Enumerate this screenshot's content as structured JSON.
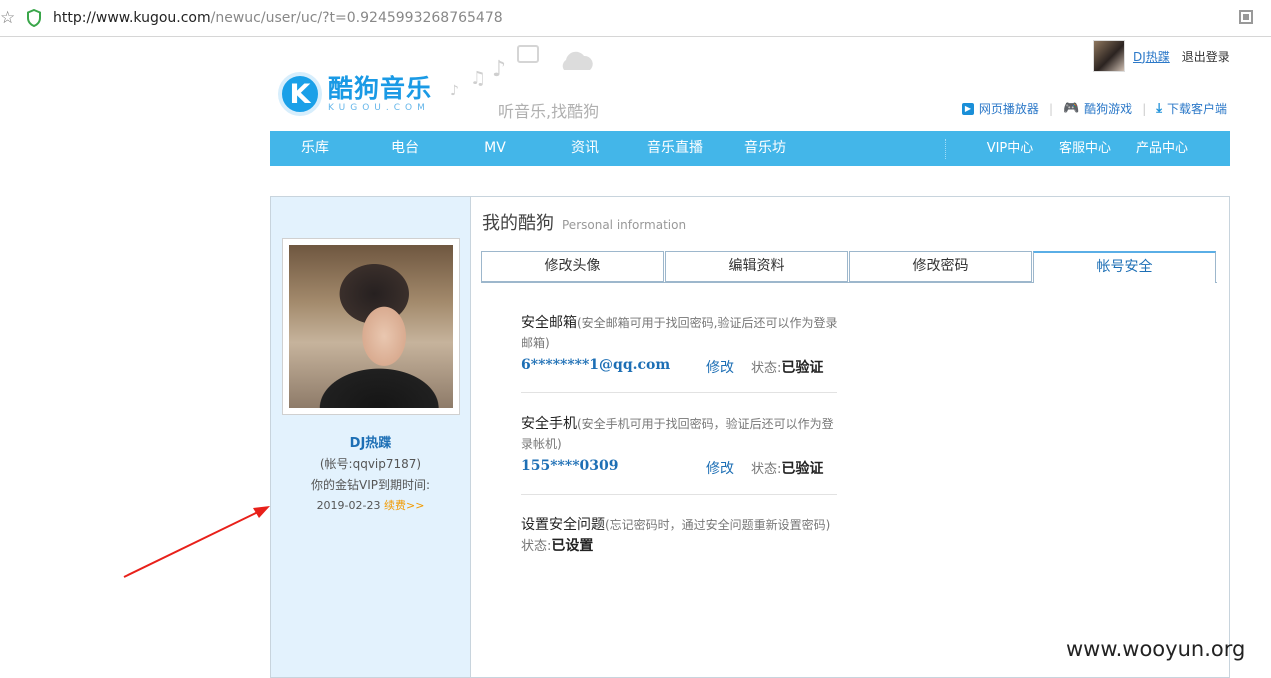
{
  "browser": {
    "url_host": "http://www.kugou.com",
    "url_rest": "/newuc/user/uc/?t=0.9245993268765478"
  },
  "header": {
    "logo_letter": "K",
    "logo_cn": "酷狗音乐",
    "logo_en": "KUGOU.COM",
    "slogan": "听音乐,找酷狗",
    "user_name": "DJ热蹀",
    "logout": "退出登录",
    "links": [
      "网页播放器",
      "酷狗游戏",
      "下载客户端"
    ]
  },
  "nav": {
    "items": [
      "乐库",
      "电台",
      "MV",
      "资讯",
      "音乐直播",
      "音乐坊"
    ],
    "right_items": [
      "VIP中心",
      "客服中心",
      "产品中心"
    ]
  },
  "sidebar": {
    "name": "DJ热蹀",
    "account": "(帐号:qqvip7187)",
    "vip_label": "你的金钻VIP到期时间:",
    "vip_date": "2019-02-23",
    "renew": "续费>>"
  },
  "main": {
    "title": "我的酷狗",
    "title_en": "Personal information",
    "tabs": [
      "修改头像",
      "编辑资料",
      "修改密码",
      "帐号安全"
    ],
    "active_tab": "帐号安全",
    "sections": [
      {
        "title": "安全邮箱",
        "note": "(安全邮箱可用于找回密码,验证后还可以作为登录邮箱)",
        "value": "6********1@qq.com",
        "edit": "修改",
        "status_label": "状态:",
        "status": "已验证"
      },
      {
        "title": "安全手机",
        "note": "(安全手机可用于找回密码，验证后还可以作为登录帐机)",
        "value": "155****0309",
        "edit": "修改",
        "status_label": "状态:",
        "status": "已验证"
      },
      {
        "title": "设置安全问题",
        "note": "(忘记密码时，通过安全问题重新设置密码)",
        "status_label": "状态:",
        "status": "已设置"
      }
    ]
  },
  "watermark": "www.wooyun.org",
  "colors": {
    "nav_bg": "#43b6e9",
    "sidebar_bg": "#e3f2fd",
    "link": "#1d6fb5",
    "renew": "#f29a00",
    "arrow": "#e8201a"
  }
}
